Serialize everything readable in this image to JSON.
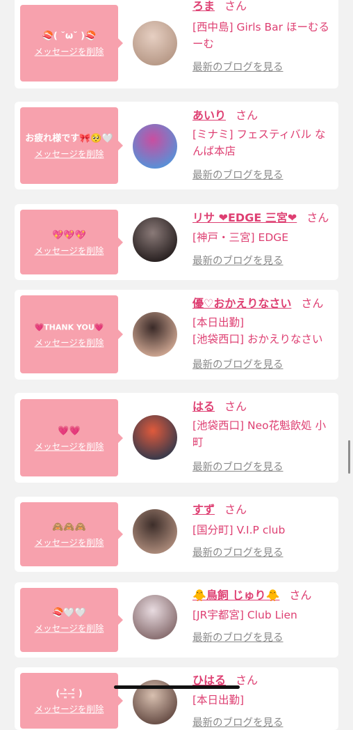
{
  "cards": [
    {
      "message": "🍣( ˘ω˘ )🍣",
      "delete_label": "メッセージを削除",
      "name": "ろま",
      "san": "さん",
      "shop_lines": [
        "[西中島] Girls Bar ほーむるーむ"
      ],
      "blog_label": "最新のブログを見る",
      "avatar_colors": [
        "#e6cfc2",
        "#b89a88"
      ]
    },
    {
      "message": "お疲れ様です🎀🥺🤍",
      "delete_label": "メッセージを削除",
      "name": "あいり",
      "san": "さん",
      "shop_lines": [
        "[ミナミ] フェスティバル なんば本店"
      ],
      "blog_label": "最新のブログを見る",
      "avatar_colors": [
        "#c94ea0",
        "#5a8fd6"
      ]
    },
    {
      "message": "💖💖💖",
      "delete_label": "メッセージを削除",
      "name": "リサ ❤EDGE 三宮❤",
      "san": "さん",
      "shop_lines": [
        "[神戸・三宮] EDGE"
      ],
      "blog_label": "最新のブログを見る",
      "avatar_colors": [
        "#8a7a78",
        "#2a2222"
      ]
    },
    {
      "message": "💗THANK YOU💗",
      "delete_label": "メッセージを削除",
      "name": "優♡おかえりなさい",
      "san": "さん",
      "shop_lines": [
        "[本日出勤]",
        "[池袋西口] おかえりなさい"
      ],
      "blog_label": "最新のブログを見る",
      "avatar_colors": [
        "#3a2a28",
        "#c9a28e"
      ]
    },
    {
      "message": "💗💗",
      "delete_label": "メッセージを削除",
      "name": "はる",
      "san": "さん",
      "shop_lines": [
        "[池袋西口] Neo花魁飲処 小町"
      ],
      "blog_label": "最新のブログを見る",
      "avatar_colors": [
        "#e05a3c",
        "#3b3a4a"
      ]
    },
    {
      "message": "🙈🙈🙈",
      "delete_label": "メッセージを削除",
      "name": "すず",
      "san": "さん",
      "shop_lines": [
        "[国分町] V.I.P club"
      ],
      "blog_label": "最新のブログを見る",
      "avatar_colors": [
        "#3d2e2a",
        "#a98878"
      ]
    },
    {
      "message": "🍣🤍🤍",
      "delete_label": "メッセージを削除",
      "name": "🐥鳥飼 じゅり🐥",
      "san": "さん",
      "shop_lines": [
        "[JR宇都宮] Club Lien"
      ],
      "blog_label": "最新のブログを見る",
      "avatar_colors": [
        "#e8dbe0",
        "#8a7072"
      ]
    },
    {
      "message": "( ˃̶͈̀ ˂̶͈́ )",
      "delete_label": "メッセージを削除",
      "name": "ひはる",
      "san": "さん",
      "shop_lines": [
        "[本日出勤]"
      ],
      "blog_label": "最新のブログを見る",
      "avatar_colors": [
        "#d8c0b0",
        "#6a5048"
      ]
    }
  ]
}
